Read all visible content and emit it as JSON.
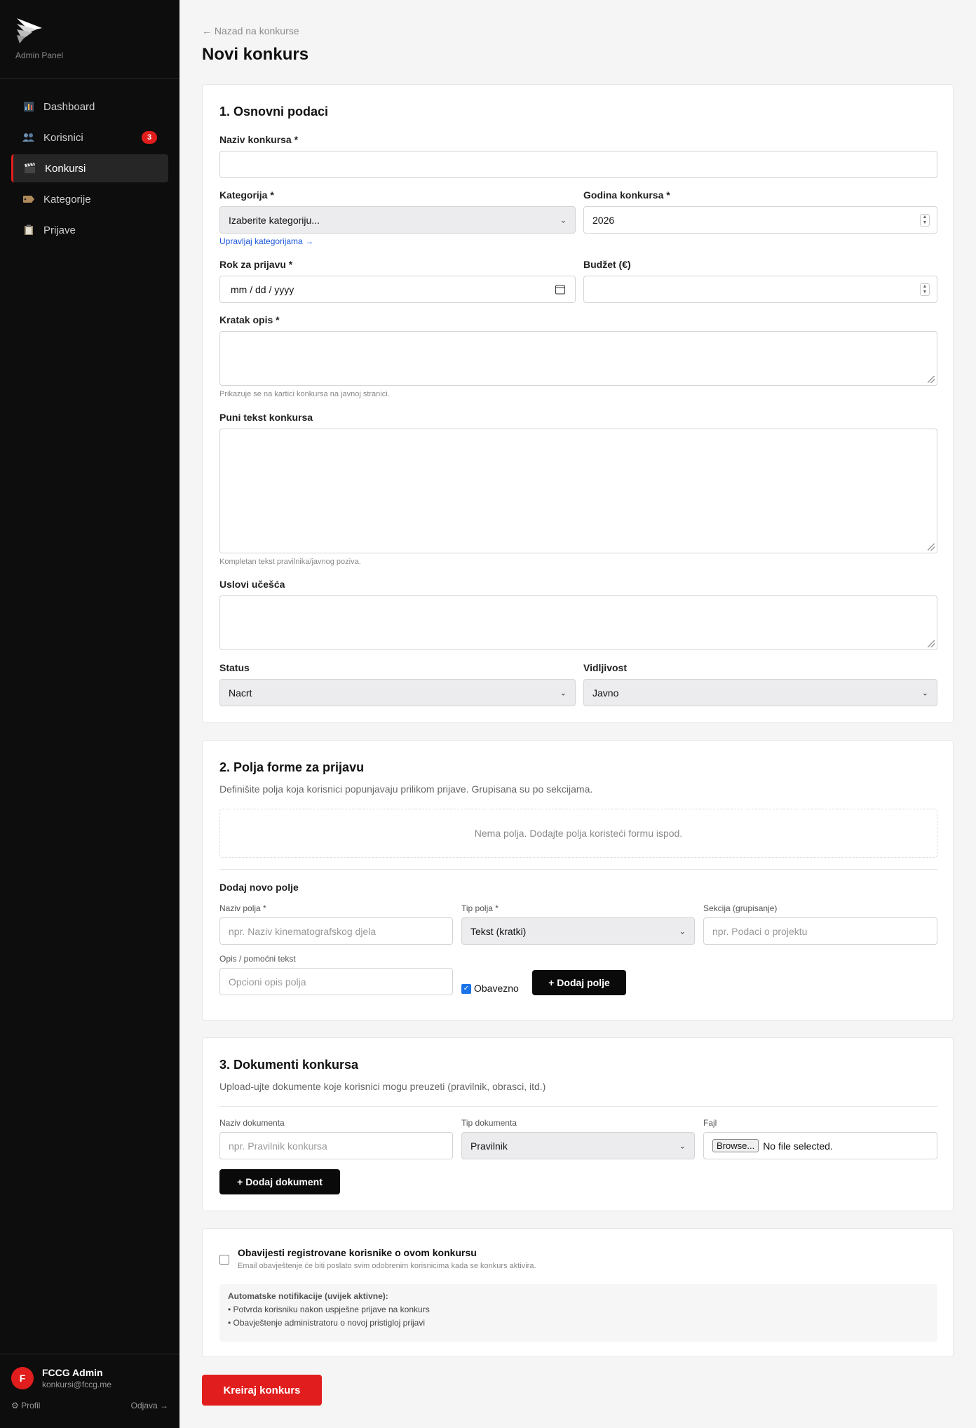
{
  "sidebar": {
    "brand_sub": "Admin Panel",
    "items": [
      {
        "label": "Dashboard",
        "icon": "bar-chart-icon"
      },
      {
        "label": "Korisnici",
        "icon": "users-icon",
        "badge": "3"
      },
      {
        "label": "Konkursi",
        "icon": "clapperboard-icon",
        "active": true
      },
      {
        "label": "Kategorije",
        "icon": "tag-icon"
      },
      {
        "label": "Prijave",
        "icon": "clipboard-icon"
      }
    ],
    "user": {
      "initial": "F",
      "name": "FCCG Admin",
      "email": "konkursi@fccg.me",
      "profile_label": "Profil",
      "logout_label": "Odjava →"
    }
  },
  "header": {
    "back_label": "← Nazad na konkurse",
    "title": "Novi konkurs"
  },
  "section1": {
    "title": "1. Osnovni podaci",
    "naziv_label": "Naziv konkursa *",
    "naziv_value": "",
    "kategorija_label": "Kategorija *",
    "kategorija_value": "Izaberite kategoriju...",
    "upravljaj_link": "Upravljaj kategorijama →",
    "godina_label": "Godina konkursa *",
    "godina_value": "2026",
    "rok_label": "Rok za prijavu *",
    "rok_value": "mm / dd / yyyy",
    "budzet_label": "Budžet (€)",
    "budzet_value": "",
    "kratak_label": "Kratak opis *",
    "kratak_help": "Prikazuje se na kartici konkursa na javnoj stranici.",
    "puni_label": "Puni tekst konkursa",
    "puni_help": "Kompletan tekst pravilnika/javnog poziva.",
    "uslovi_label": "Uslovi učešća",
    "status_label": "Status",
    "status_value": "Nacrt",
    "vidljivost_label": "Vidljivost",
    "vidljivost_value": "Javno"
  },
  "section2": {
    "title": "2. Polja forme za prijavu",
    "desc": "Definišite polja koja korisnici popunjavaju prilikom prijave. Grupisana su po sekcijama.",
    "empty": "Nema polja. Dodajte polja koristeći formu ispod.",
    "add_title": "Dodaj novo polje",
    "naziv_polja_label": "Naziv polja *",
    "naziv_polja_placeholder": "npr. Naziv kinematografskog djela",
    "tip_polja_label": "Tip polja *",
    "tip_polja_value": "Tekst (kratki)",
    "sekcija_label": "Sekcija (grupisanje)",
    "sekcija_placeholder": "npr. Podaci o projektu",
    "opis_label": "Opis / pomoćni tekst",
    "opis_placeholder": "Opcioni opis polja",
    "obavezno_label": "Obavezno",
    "add_button": "+ Dodaj polje"
  },
  "section3": {
    "title": "3. Dokumenti konkursa",
    "desc": "Upload-ujte dokumente koje korisnici mogu preuzeti (pravilnik, obrasci, itd.)",
    "naziv_label": "Naziv dokumenta",
    "naziv_placeholder": "npr. Pravilnik konkursa",
    "tip_label": "Tip dokumenta",
    "tip_value": "Pravilnik",
    "fajl_label": "Fajl",
    "browse_label": "Browse...",
    "no_file": "No file selected.",
    "add_button": "+ Dodaj dokument"
  },
  "section4": {
    "notify_label": "Obavijesti registrovane korisnike o ovom konkursu",
    "notify_help": "Email obavještenje će biti poslato svim odobrenim korisnicima kada se konkurs aktivira.",
    "auto_title": "Automatske notifikacije (uvijek aktivne):",
    "auto_items": [
      "• Potvrda korisniku nakon uspješne prijave na konkurs",
      "• Obavještenje administratoru o novoj pristigloj prijavi"
    ]
  },
  "submit_label": "Kreiraj konkurs",
  "colors": {
    "accent": "#e11d1d",
    "sidebar_bg": "#0d0d0d",
    "link": "#1a56db"
  }
}
